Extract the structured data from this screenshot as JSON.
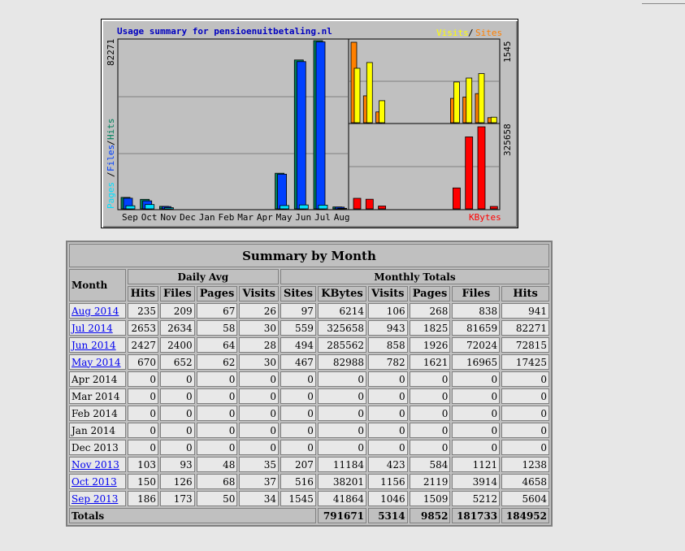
{
  "graph": {
    "title": "Usage summary for pensioenuitbetaling.nl",
    "legend_visits": "Visits",
    "legend_slash": "/",
    "legend_sites": "Sites",
    "kbytes_label": "KBytes",
    "left_label_pages": "Pages",
    "left_label_files": "Files",
    "left_label_hits": "Hits",
    "left_max": "82271",
    "right_top_max": "1545",
    "right_bottom_max": "325658",
    "colors": {
      "hits": "#00805c",
      "files": "#0040ff",
      "pages": "#00e0ff",
      "visits": "#ffff00",
      "sites": "#ff8000",
      "kbytes": "#ff0000"
    }
  },
  "chart_data": {
    "type": "bar",
    "categories": [
      "Sep",
      "Oct",
      "Nov",
      "Dec",
      "Jan",
      "Feb",
      "Mar",
      "Apr",
      "May",
      "Jun",
      "Jul",
      "Aug"
    ],
    "series": [
      {
        "name": "Hits",
        "values": [
          5604,
          4658,
          1238,
          0,
          0,
          0,
          0,
          0,
          17425,
          72815,
          82271,
          941
        ]
      },
      {
        "name": "Files",
        "values": [
          5212,
          3914,
          1121,
          0,
          0,
          0,
          0,
          0,
          16965,
          72024,
          81659,
          838
        ]
      },
      {
        "name": "Pages",
        "values": [
          1509,
          2119,
          584,
          0,
          0,
          0,
          0,
          0,
          1621,
          1926,
          1825,
          268
        ]
      },
      {
        "name": "Visits",
        "values": [
          1046,
          1156,
          423,
          0,
          0,
          0,
          0,
          0,
          782,
          858,
          943,
          106
        ]
      },
      {
        "name": "Sites",
        "values": [
          1545,
          516,
          207,
          0,
          0,
          0,
          0,
          0,
          467,
          494,
          559,
          97
        ]
      },
      {
        "name": "KBytes",
        "values": [
          41864,
          38201,
          11184,
          0,
          0,
          0,
          0,
          0,
          82988,
          285562,
          325658,
          6214
        ]
      }
    ]
  },
  "summary": {
    "title": "Summary by Month",
    "month_label": "Month",
    "daily_avg_label": "Daily Avg",
    "monthly_totals_label": "Monthly Totals",
    "daily_headers": [
      "Hits",
      "Files",
      "Pages",
      "Visits"
    ],
    "monthly_headers": [
      "Sites",
      "KBytes",
      "Visits",
      "Pages",
      "Files",
      "Hits"
    ],
    "rows": [
      {
        "month": "Aug 2014",
        "link": true,
        "v": [
          "235",
          "209",
          "67",
          "26",
          "97",
          "6214",
          "106",
          "268",
          "838",
          "941"
        ]
      },
      {
        "month": "Jul 2014",
        "link": true,
        "v": [
          "2653",
          "2634",
          "58",
          "30",
          "559",
          "325658",
          "943",
          "1825",
          "81659",
          "82271"
        ]
      },
      {
        "month": "Jun 2014",
        "link": true,
        "v": [
          "2427",
          "2400",
          "64",
          "28",
          "494",
          "285562",
          "858",
          "1926",
          "72024",
          "72815"
        ]
      },
      {
        "month": "May 2014",
        "link": true,
        "v": [
          "670",
          "652",
          "62",
          "30",
          "467",
          "82988",
          "782",
          "1621",
          "16965",
          "17425"
        ]
      },
      {
        "month": "Apr 2014",
        "link": false,
        "v": [
          "0",
          "0",
          "0",
          "0",
          "0",
          "0",
          "0",
          "0",
          "0",
          "0"
        ]
      },
      {
        "month": "Mar 2014",
        "link": false,
        "v": [
          "0",
          "0",
          "0",
          "0",
          "0",
          "0",
          "0",
          "0",
          "0",
          "0"
        ]
      },
      {
        "month": "Feb 2014",
        "link": false,
        "v": [
          "0",
          "0",
          "0",
          "0",
          "0",
          "0",
          "0",
          "0",
          "0",
          "0"
        ]
      },
      {
        "month": "Jan 2014",
        "link": false,
        "v": [
          "0",
          "0",
          "0",
          "0",
          "0",
          "0",
          "0",
          "0",
          "0",
          "0"
        ]
      },
      {
        "month": "Dec 2013",
        "link": false,
        "v": [
          "0",
          "0",
          "0",
          "0",
          "0",
          "0",
          "0",
          "0",
          "0",
          "0"
        ]
      },
      {
        "month": "Nov 2013",
        "link": true,
        "v": [
          "103",
          "93",
          "48",
          "35",
          "207",
          "11184",
          "423",
          "584",
          "1121",
          "1238"
        ]
      },
      {
        "month": "Oct 2013",
        "link": true,
        "v": [
          "150",
          "126",
          "68",
          "37",
          "516",
          "38201",
          "1156",
          "2119",
          "3914",
          "4658"
        ]
      },
      {
        "month": "Sep 2013",
        "link": true,
        "v": [
          "186",
          "173",
          "50",
          "34",
          "1545",
          "41864",
          "1046",
          "1509",
          "5212",
          "5604"
        ]
      }
    ],
    "totals_label": "Totals",
    "totals": [
      "791671",
      "5314",
      "9852",
      "181733",
      "184952"
    ]
  }
}
